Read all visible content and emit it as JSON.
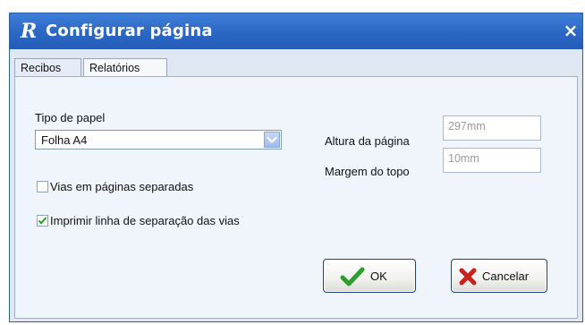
{
  "window": {
    "title": "Configurar página",
    "close_label": "×"
  },
  "tabs": [
    {
      "label": "Recibos"
    },
    {
      "label": "Relatórios"
    }
  ],
  "form": {
    "tipo_papel_label": "Tipo de papel",
    "tipo_papel_value": "Folha A4",
    "vias_separadas_label": "Vias em páginas separadas",
    "vias_separadas_checked": false,
    "linha_separacao_label": "Imprimir linha de separação das vias",
    "linha_separacao_checked": true,
    "altura_label": "Altura da página",
    "altura_value": "297mm",
    "margem_label": "Margem do topo",
    "margem_value": "10mm"
  },
  "buttons": {
    "ok_label": "OK",
    "cancel_label": "Cancelar"
  },
  "colors": {
    "titlebar": "#2a67c4",
    "ok_icon": "#2e9e2e",
    "cancel_icon": "#c8221a"
  },
  "icons": [
    "app-logo-icon",
    "close-icon",
    "dropdown-arrow-icon",
    "checkmark-icon",
    "cancel-x-icon"
  ]
}
